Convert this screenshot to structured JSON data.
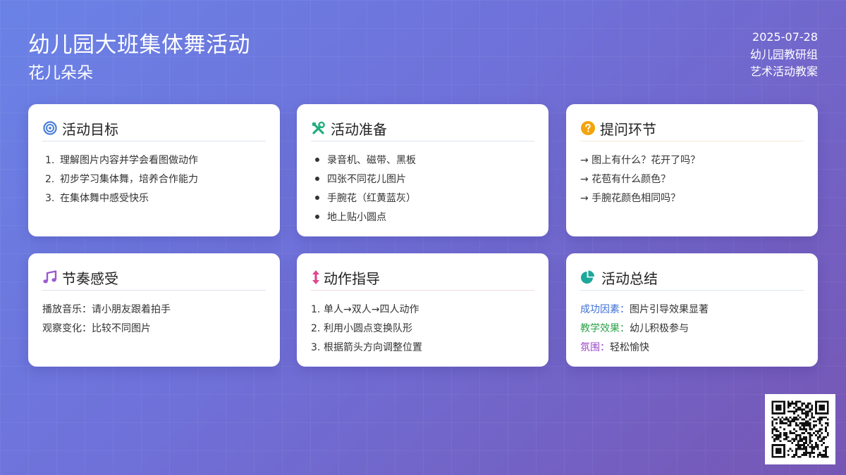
{
  "header": {
    "title": "幼儿园大班集体舞活动",
    "subtitle": "花儿朵朵",
    "date": "2025-07-28",
    "org": "幼儿园教研组",
    "category": "艺术活动教案"
  },
  "cards": {
    "goals": {
      "icon": "target-icon",
      "icon_color": "#4a7fd9",
      "title": "活动目标",
      "items": [
        {
          "num": "1.",
          "text": "理解图片内容并学会看图做动作"
        },
        {
          "num": "2.",
          "text": "初步学习集体舞，培养合作能力"
        },
        {
          "num": "3.",
          "text": "在集体舞中感受快乐"
        }
      ]
    },
    "prep": {
      "icon": "tools-icon",
      "icon_color": "#1fae7a",
      "title": "活动准备",
      "items": [
        "录音机、磁带、黑板",
        "四张不同花儿图片",
        "手腕花（红黄蓝灰）",
        "地上贴小圆点"
      ]
    },
    "questions": {
      "icon": "question-circle-icon",
      "icon_color": "#f2a40d",
      "title": "提问环节",
      "items": [
        "→ 图上有什么？花开了吗？",
        "→ 花苞有什么颜色？",
        "→ 手腕花颜色相同吗？"
      ]
    },
    "rhythm": {
      "icon": "music-note-icon",
      "icon_color": "#9b59d0",
      "title": "节奏感受",
      "items": [
        "播放音乐：请小朋友跟着拍手",
        "观察变化：比较不同图片"
      ]
    },
    "moves": {
      "icon": "arrows-vertical-icon",
      "icon_color": "#e0458d",
      "title": "动作指导",
      "items": [
        {
          "num": "1.",
          "text": "单人→双人→四人动作"
        },
        {
          "num": "2.",
          "text": "利用小圆点变换队形"
        },
        {
          "num": "3.",
          "text": "根据箭头方向调整位置"
        }
      ]
    },
    "summary": {
      "icon": "pie-chart-icon",
      "icon_color": "#1aa89a",
      "title": "活动总结",
      "items": [
        {
          "label": "成功因素",
          "sep": "：",
          "text": "图片引导效果显著"
        },
        {
          "label": "教学效果",
          "sep": "：",
          "text": "幼儿积极参与"
        },
        {
          "label": "氛围",
          "sep": "：",
          "text": "轻松愉快"
        }
      ]
    }
  },
  "qr_icon": "qr-code-icon"
}
